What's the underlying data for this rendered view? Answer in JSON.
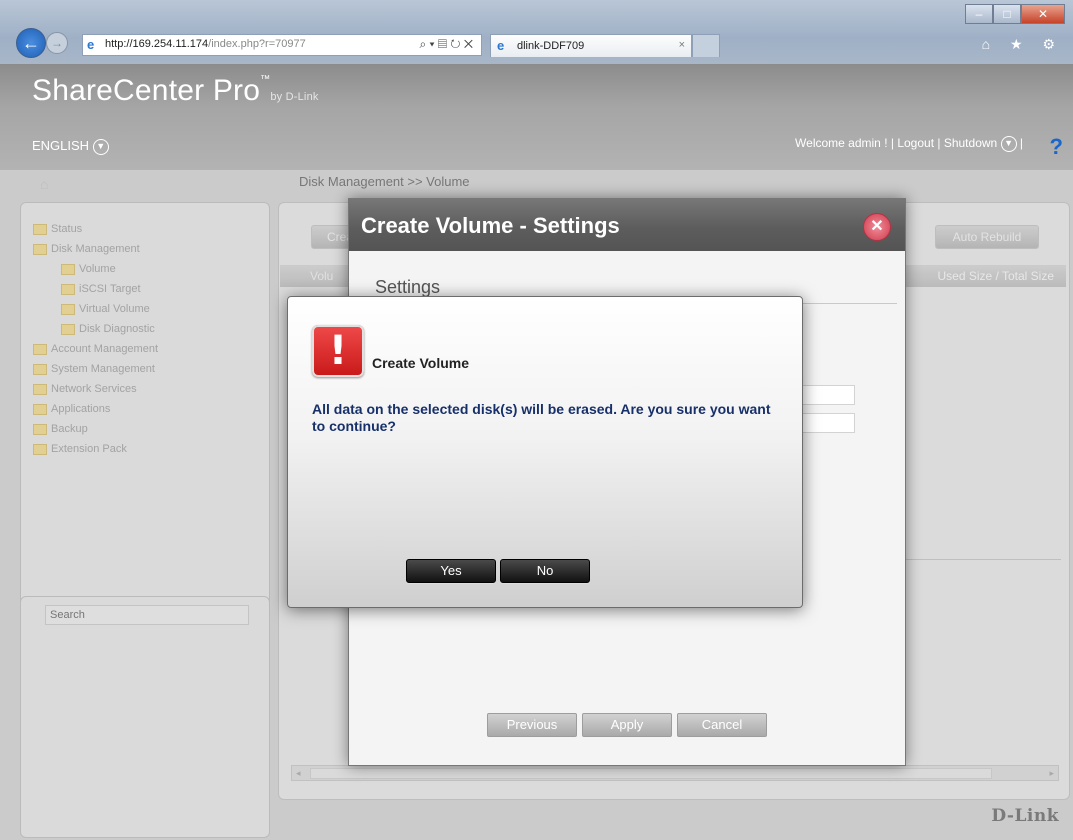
{
  "browser": {
    "url_host": "http://169.254.11.174",
    "url_path": "/index.php?r=70977",
    "tab_title": "dlink-DDF709",
    "tab_close": "×",
    "toolbar_icons": "⌂ ★ ⚙",
    "addr_tools": "⌕ ▾ ▤ ↻ ✕"
  },
  "app": {
    "brand": "ShareCenter Pro",
    "brand_tm": "™",
    "brand_by": "by D-Link",
    "language": "ENGLISH",
    "welcome": "Welcome admin !",
    "logout": "Logout",
    "shutdown": "Shutdown",
    "help": "?"
  },
  "breadcrumb": "Disk Management >> Volume",
  "sidebar": {
    "items": [
      {
        "label": "Status",
        "level": 0
      },
      {
        "label": "Disk Management",
        "level": 0
      },
      {
        "label": "Volume",
        "level": 1
      },
      {
        "label": "iSCSI Target",
        "level": 1
      },
      {
        "label": "Virtual Volume",
        "level": 1
      },
      {
        "label": "Disk Diagnostic",
        "level": 1
      },
      {
        "label": "Account Management",
        "level": 0
      },
      {
        "label": "System Management",
        "level": 0
      },
      {
        "label": "Network Services",
        "level": 0
      },
      {
        "label": "Applications",
        "level": 0
      },
      {
        "label": "Backup",
        "level": 0
      },
      {
        "label": "Extension Pack",
        "level": 0
      }
    ]
  },
  "search": {
    "placeholder": "Search"
  },
  "volume_panel": {
    "create_button": "Create",
    "auto_rebuild_button": "Auto Rebuild",
    "header_left": "Volu",
    "header_right": "Used Size / Total Size"
  },
  "settings_dialog": {
    "title": "Create Volume - Settings",
    "section": "Settings",
    "previous": "Previous",
    "apply": "Apply",
    "cancel": "Cancel"
  },
  "confirm_dialog": {
    "title": "Create Volume",
    "message": "All data on the selected disk(s) will be erased. Are you sure you want to continue?",
    "yes": "Yes",
    "no": "No"
  },
  "footer_logo": "D-Link"
}
